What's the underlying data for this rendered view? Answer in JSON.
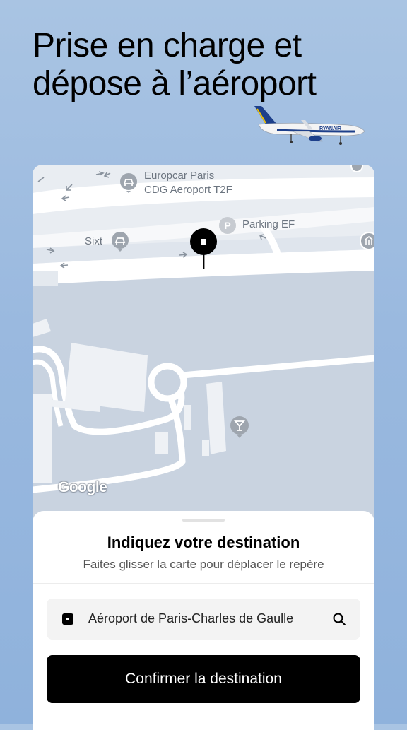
{
  "headline": {
    "line1": "Prise en charge et",
    "line2": "dépose à l’aéroport"
  },
  "plane": {
    "livery": "RYANAIR"
  },
  "map": {
    "pois": [
      {
        "line1": "Europcar Paris",
        "line2": "CDG Aeroport T2F",
        "icon": "car-rental-icon"
      },
      {
        "line1": "Parking EF",
        "icon": "parking-icon"
      },
      {
        "line1": "Sixt",
        "icon": "car-rental-icon"
      }
    ],
    "parking_letter": "P",
    "attribution": "Google"
  },
  "sheet": {
    "title": "Indiquez votre destination",
    "subtitle": "Faites glisser la carte pour déplacer le repère",
    "destination_value": "Aéroport de Paris-Charles de Gaulle",
    "confirm_label": "Confirmer la destination"
  },
  "colors": {
    "background": "#9ab9df",
    "map_land": "#e6ebf1",
    "map_water": "#c9d3e0",
    "road": "#ffffff",
    "primary_button": "#000000"
  }
}
